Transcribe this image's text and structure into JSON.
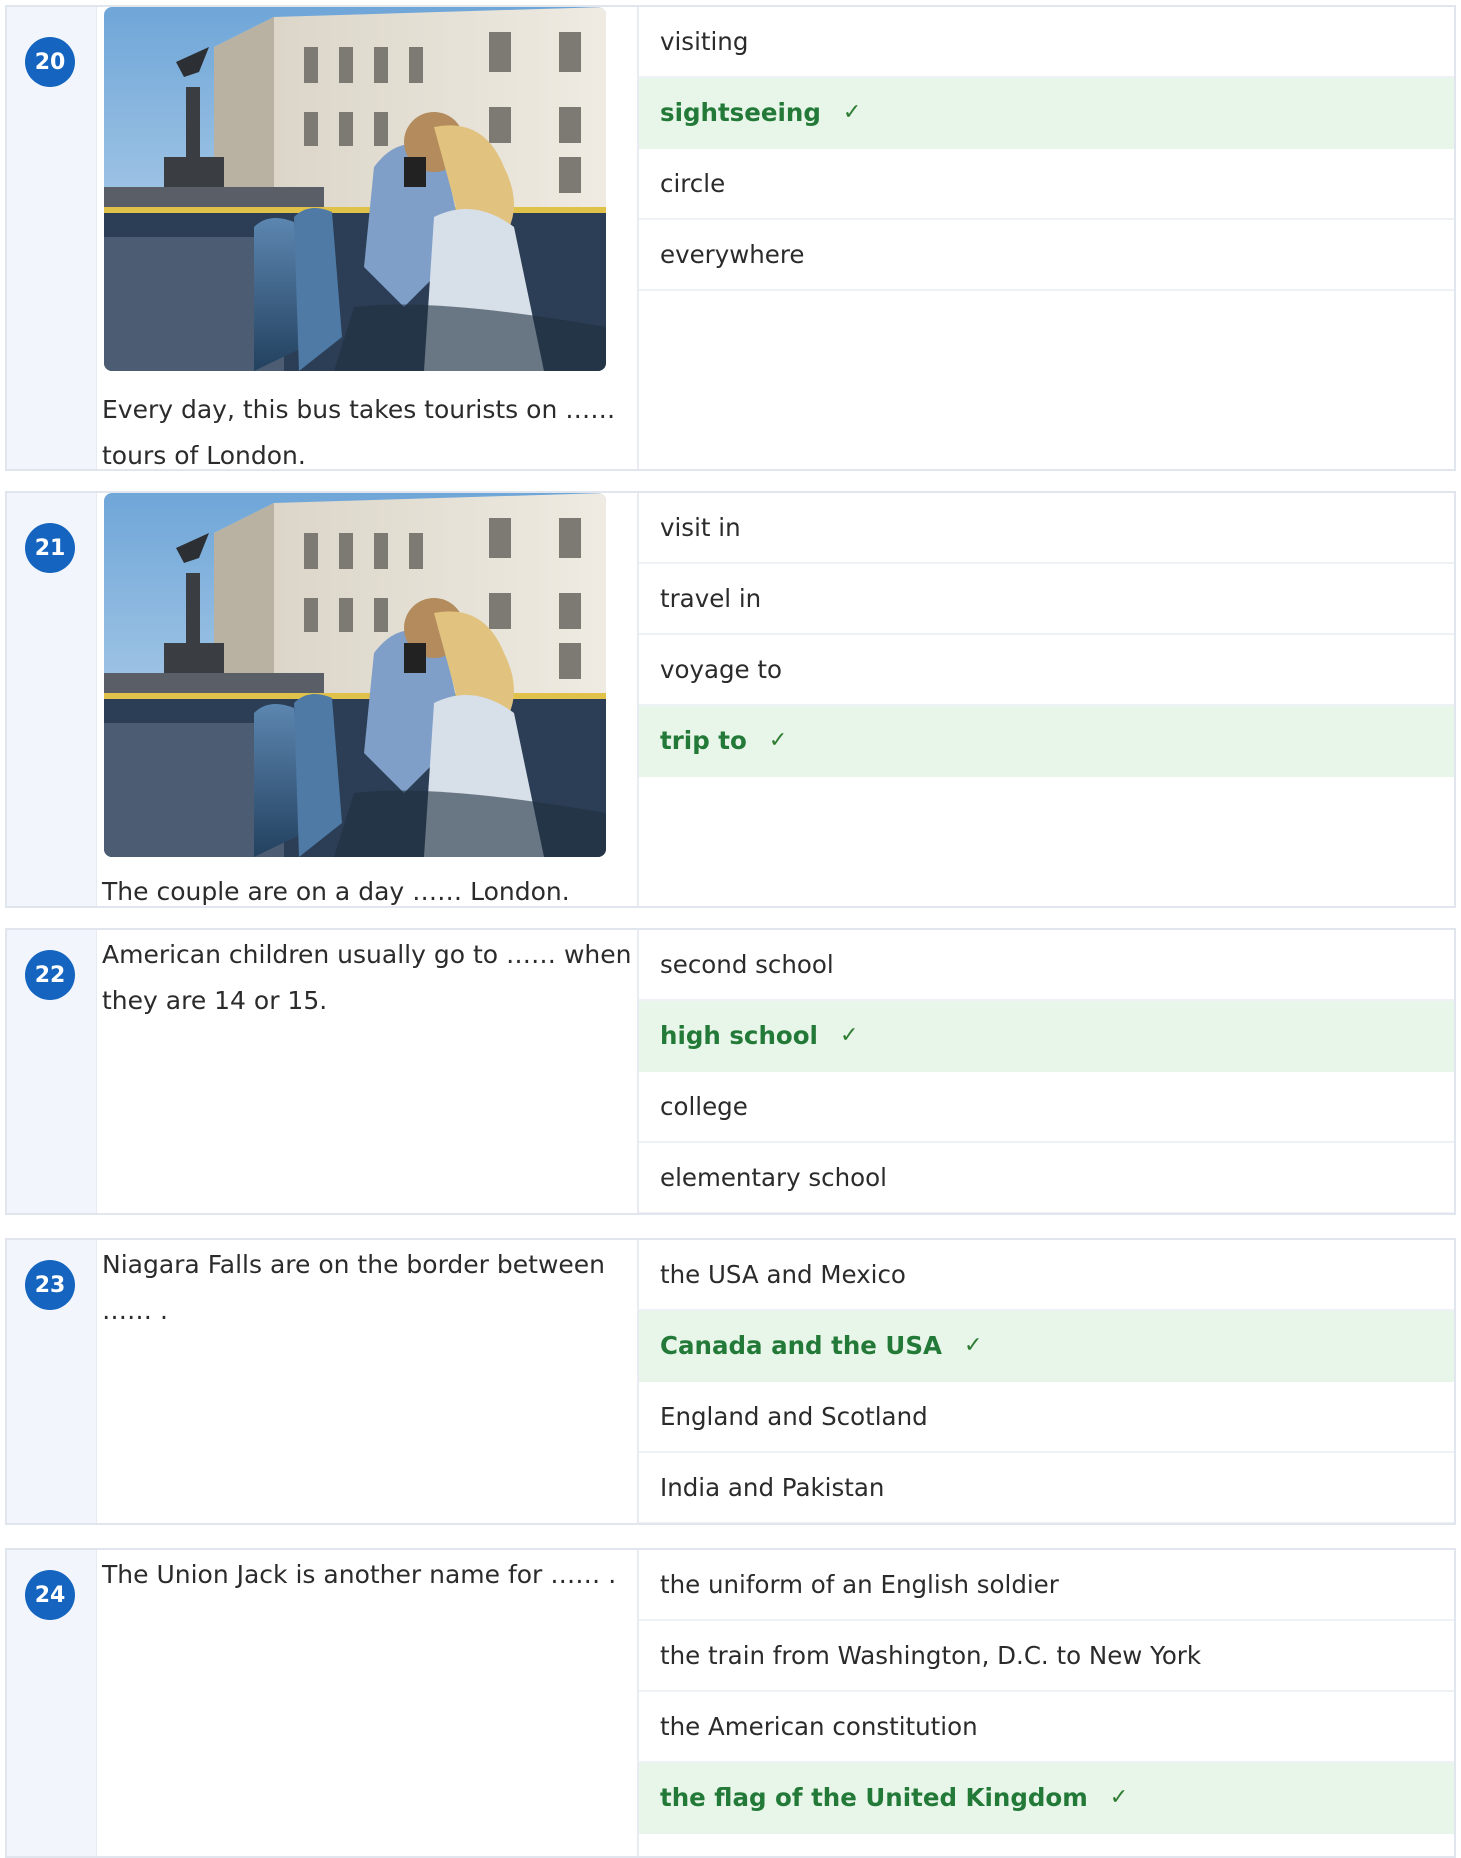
{
  "colors": {
    "accent": "#1565c0",
    "correct_bg": "#e8f5e9",
    "correct_text": "#237a38",
    "number_column_bg": "#f2f6fc"
  },
  "check_mark": "✓",
  "questions": [
    {
      "number": "20",
      "has_image": true,
      "text": "Every day, this bus takes tourists on …… tours of London.",
      "options": [
        {
          "label": "visiting",
          "correct": false
        },
        {
          "label": "sightseeing",
          "correct": true
        },
        {
          "label": "circle",
          "correct": false
        },
        {
          "label": "everywhere",
          "correct": false
        }
      ]
    },
    {
      "number": "21",
      "has_image": true,
      "text": "The couple are on a day …… London.",
      "options": [
        {
          "label": "visit in",
          "correct": false
        },
        {
          "label": "travel in",
          "correct": false
        },
        {
          "label": "voyage to",
          "correct": false
        },
        {
          "label": "trip to",
          "correct": true
        }
      ]
    },
    {
      "number": "22",
      "has_image": false,
      "text": "American children usually go to …… when they are 14 or 15.",
      "options": [
        {
          "label": "second school",
          "correct": false
        },
        {
          "label": "high school",
          "correct": true
        },
        {
          "label": "college",
          "correct": false
        },
        {
          "label": "elementary school",
          "correct": false
        }
      ]
    },
    {
      "number": "23",
      "has_image": false,
      "text": "Niagara Falls are on the border between …… .",
      "options": [
        {
          "label": "the USA and Mexico",
          "correct": false
        },
        {
          "label": "Canada and the USA",
          "correct": true
        },
        {
          "label": "England and Scotland",
          "correct": false
        },
        {
          "label": "India and Pakistan",
          "correct": false
        }
      ]
    },
    {
      "number": "24",
      "has_image": false,
      "text": "The Union Jack is another name for …… .",
      "options": [
        {
          "label": "the uniform of an English soldier",
          "correct": false
        },
        {
          "label": "the train from Washington, D.C. to New York",
          "correct": false
        },
        {
          "label": "the American constitution",
          "correct": false
        },
        {
          "label": "the flag of the United Kingdom",
          "correct": true
        }
      ]
    }
  ]
}
